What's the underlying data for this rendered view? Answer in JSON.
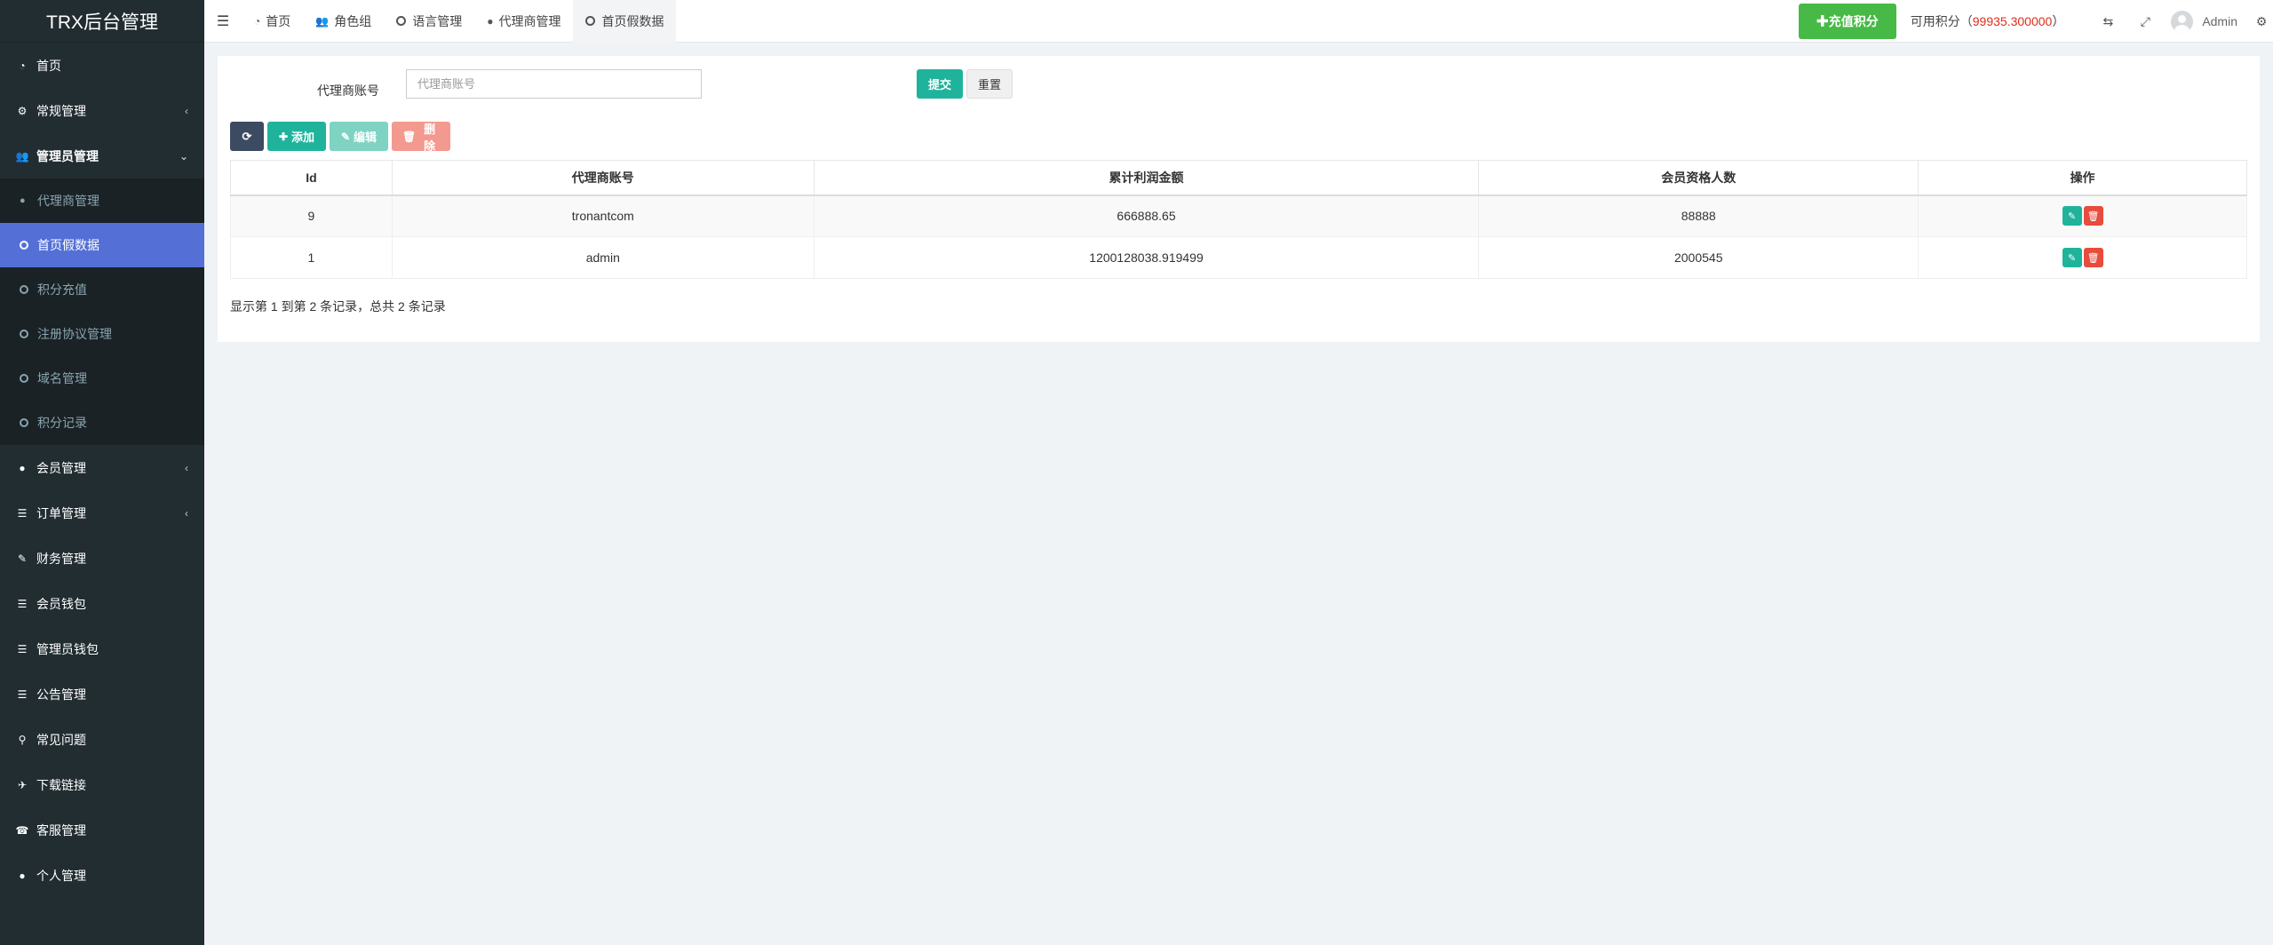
{
  "app_title": "TRX后台管理",
  "sidebar": {
    "items": [
      {
        "label": "首页",
        "icon": "dashboard-icon"
      },
      {
        "label": "常规管理",
        "icon": "gears-icon",
        "caret": "‹"
      },
      {
        "label": "管理员管理",
        "icon": "users-icon",
        "caret": "⌄"
      }
    ],
    "submenu": [
      {
        "label": "代理商管理",
        "icon": "user-icon"
      },
      {
        "label": "首页假数据",
        "icon": "circle-icon"
      },
      {
        "label": "积分充值",
        "icon": "circle-icon"
      },
      {
        "label": "注册协议管理",
        "icon": "circle-icon"
      },
      {
        "label": "域名管理",
        "icon": "circle-icon"
      },
      {
        "label": "积分记录",
        "icon": "circle-icon"
      }
    ],
    "items_after": [
      {
        "label": "会员管理",
        "icon": "user-icon",
        "caret": "‹"
      },
      {
        "label": "订单管理",
        "icon": "list-icon",
        "caret": "‹"
      },
      {
        "label": "财务管理",
        "icon": "edit-icon"
      },
      {
        "label": "会员钱包",
        "icon": "list-icon"
      },
      {
        "label": "管理员钱包",
        "icon": "list-icon"
      },
      {
        "label": "公告管理",
        "icon": "list-icon"
      },
      {
        "label": "常见问题",
        "icon": "search-icon"
      },
      {
        "label": "下载链接",
        "icon": "plane-icon"
      },
      {
        "label": "客服管理",
        "icon": "phone-icon"
      },
      {
        "label": "个人管理",
        "icon": "user-icon"
      }
    ]
  },
  "topbar": {
    "tabs": [
      {
        "label": "首页",
        "icon": "dashboard-icon"
      },
      {
        "label": "角色组",
        "icon": "users-icon"
      },
      {
        "label": "语言管理",
        "icon": "circle-icon"
      },
      {
        "label": "代理商管理",
        "icon": "user-icon"
      },
      {
        "label": "首页假数据",
        "icon": "circle-icon"
      }
    ],
    "recharge_label": "✚充值积分",
    "points_label": "可用积分（",
    "points_value": "99935.300000",
    "points_close": "）",
    "user_name": "Admin"
  },
  "filter": {
    "label": "代理商账号",
    "placeholder": "代理商账号",
    "submit": "提交",
    "reset": "重置"
  },
  "toolbar": {
    "add": "添加",
    "edit": "编辑",
    "delete": "删除"
  },
  "table": {
    "headers": [
      "Id",
      "代理商账号",
      "累计利润金额",
      "会员资格人数",
      "操作"
    ],
    "rows": [
      {
        "id": "9",
        "account": "tronantcom",
        "profit": "666888.65",
        "members": "88888"
      },
      {
        "id": "1",
        "account": "admin",
        "profit": "1200128038.919499",
        "members": "2000545"
      }
    ]
  },
  "pager_info": "显示第 1 到第 2 条记录，总共 2 条记录",
  "colors": {
    "sidebar_bg": "#222d32",
    "active_bg": "#5470d6",
    "success": "#1fb39c",
    "danger": "#e74c3c",
    "recharge": "#47b946",
    "points_value": "#e02d1b"
  }
}
